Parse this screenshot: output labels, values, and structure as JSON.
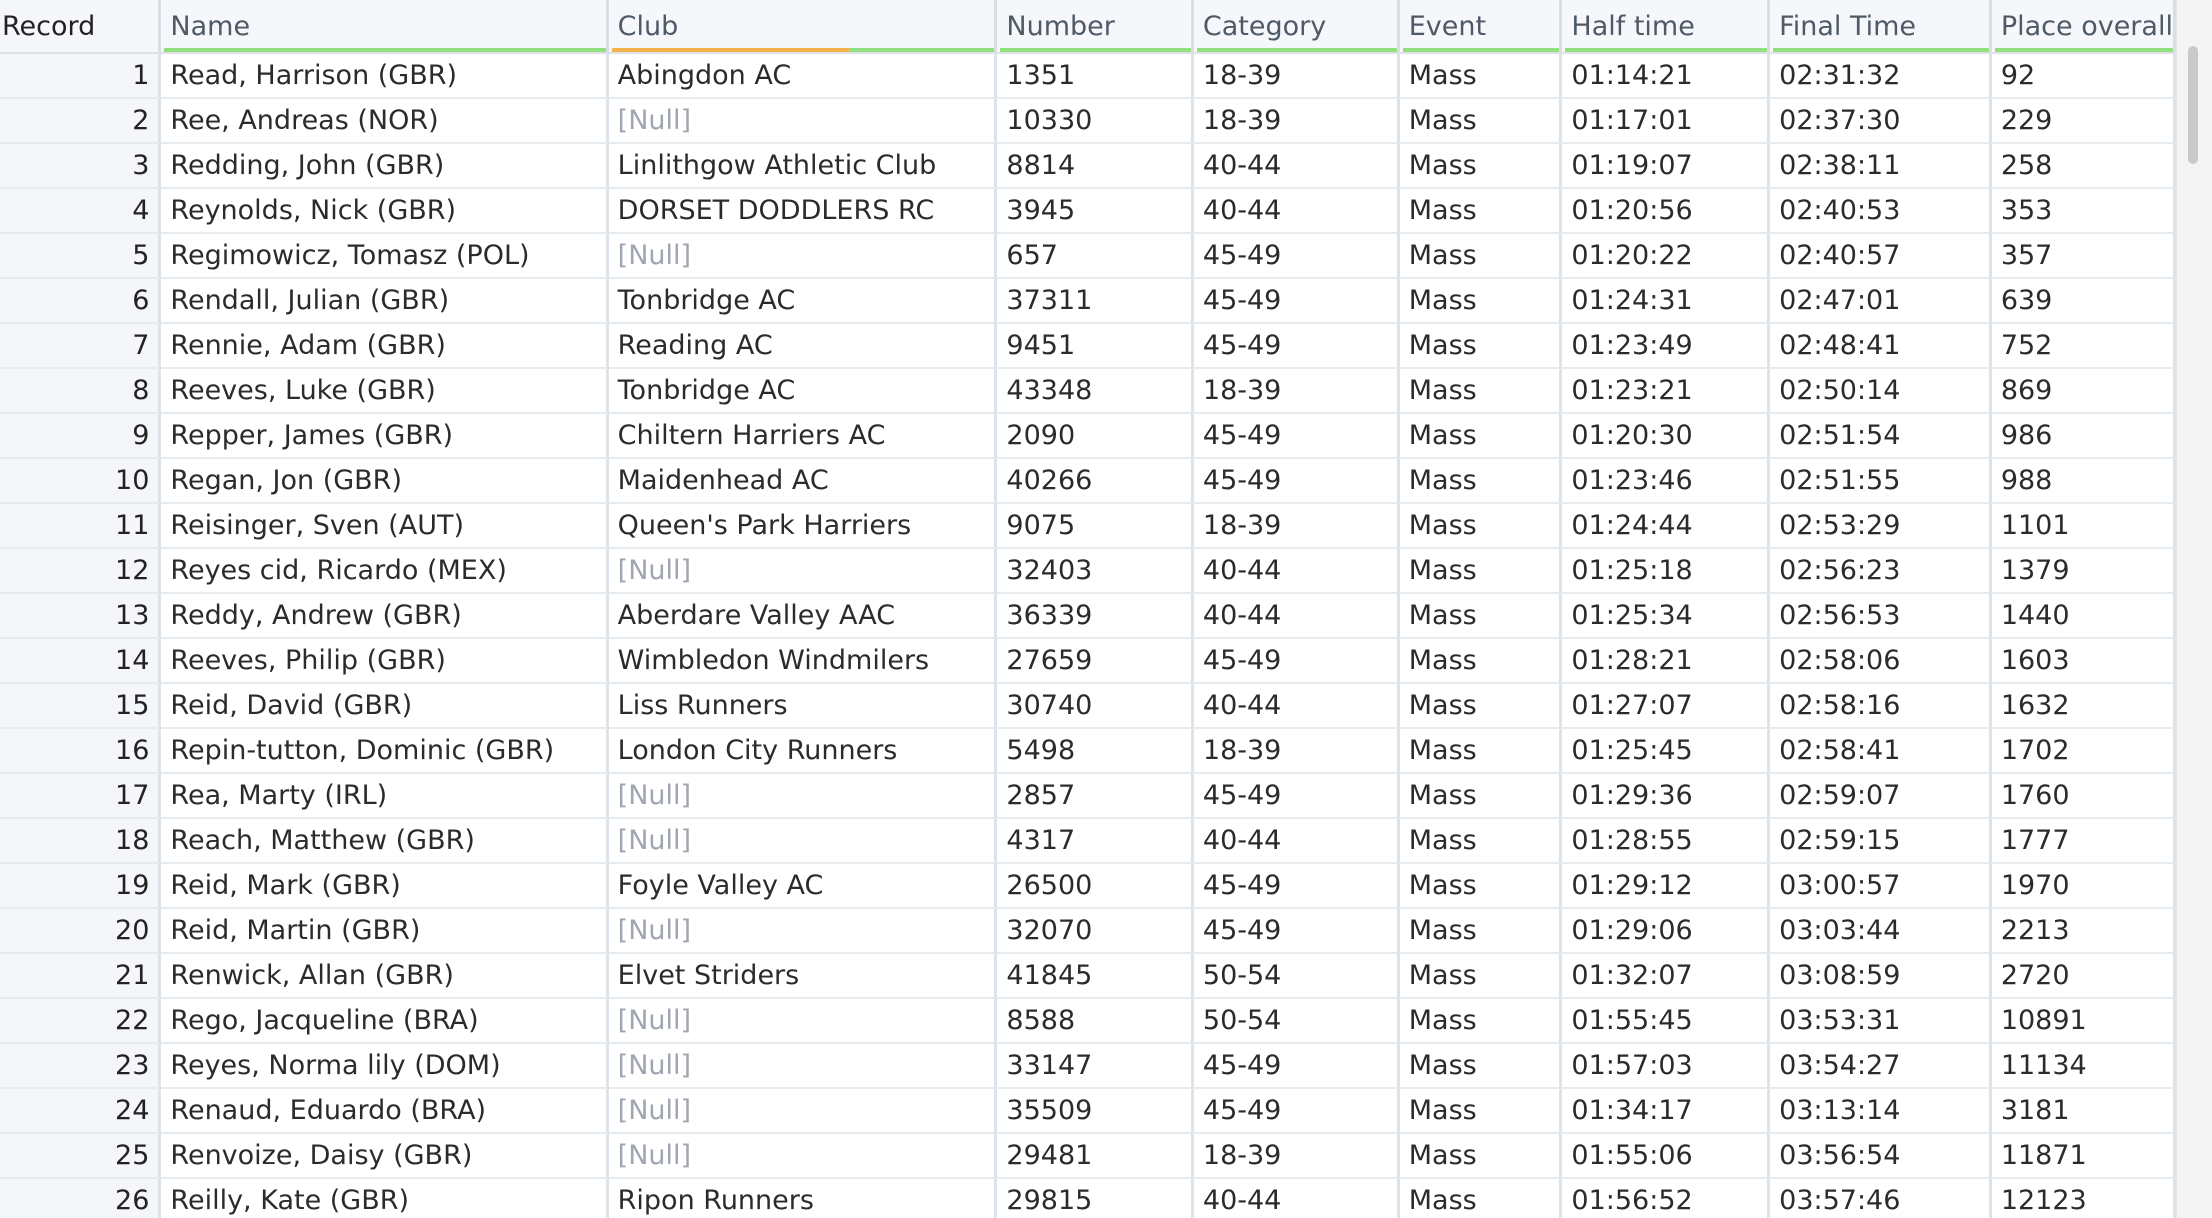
{
  "columns": [
    "Record",
    "Name",
    "Club",
    "Number",
    "Category",
    "Event",
    "Half time",
    "Final Time",
    "Place overall"
  ],
  "rows": [
    [
      "1",
      "Read, Harrison (GBR)",
      "Abingdon AC",
      "1351",
      "18-39",
      "Mass",
      "01:14:21",
      "02:31:32",
      "92"
    ],
    [
      "2",
      "Ree, Andreas (NOR)",
      "[Null]",
      "10330",
      "18-39",
      "Mass",
      "01:17:01",
      "02:37:30",
      "229"
    ],
    [
      "3",
      "Redding, John (GBR)",
      "Linlithgow Athletic Club",
      "8814",
      "40-44",
      "Mass",
      "01:19:07",
      "02:38:11",
      "258"
    ],
    [
      "4",
      "Reynolds, Nick (GBR)",
      "DORSET DODDLERS RC",
      "3945",
      "40-44",
      "Mass",
      "01:20:56",
      "02:40:53",
      "353"
    ],
    [
      "5",
      "Regimowicz, Tomasz (POL)",
      "[Null]",
      "657",
      "45-49",
      "Mass",
      "01:20:22",
      "02:40:57",
      "357"
    ],
    [
      "6",
      "Rendall, Julian (GBR)",
      "Tonbridge AC",
      "37311",
      "45-49",
      "Mass",
      "01:24:31",
      "02:47:01",
      "639"
    ],
    [
      "7",
      "Rennie, Adam (GBR)",
      "Reading AC",
      "9451",
      "45-49",
      "Mass",
      "01:23:49",
      "02:48:41",
      "752"
    ],
    [
      "8",
      "Reeves, Luke (GBR)",
      "Tonbridge AC",
      "43348",
      "18-39",
      "Mass",
      "01:23:21",
      "02:50:14",
      "869"
    ],
    [
      "9",
      "Repper, James (GBR)",
      "Chiltern Harriers AC",
      "2090",
      "45-49",
      "Mass",
      "01:20:30",
      "02:51:54",
      "986"
    ],
    [
      "10",
      "Regan, Jon (GBR)",
      "Maidenhead AC",
      "40266",
      "45-49",
      "Mass",
      "01:23:46",
      "02:51:55",
      "988"
    ],
    [
      "11",
      "Reisinger, Sven (AUT)",
      "Queen's Park Harriers",
      "9075",
      "18-39",
      "Mass",
      "01:24:44",
      "02:53:29",
      "1101"
    ],
    [
      "12",
      "Reyes cid, Ricardo (MEX)",
      "[Null]",
      "32403",
      "40-44",
      "Mass",
      "01:25:18",
      "02:56:23",
      "1379"
    ],
    [
      "13",
      "Reddy, Andrew (GBR)",
      "Aberdare Valley AAC",
      "36339",
      "40-44",
      "Mass",
      "01:25:34",
      "02:56:53",
      "1440"
    ],
    [
      "14",
      "Reeves, Philip (GBR)",
      "Wimbledon Windmilers",
      "27659",
      "45-49",
      "Mass",
      "01:28:21",
      "02:58:06",
      "1603"
    ],
    [
      "15",
      "Reid, David (GBR)",
      "Liss Runners",
      "30740",
      "40-44",
      "Mass",
      "01:27:07",
      "02:58:16",
      "1632"
    ],
    [
      "16",
      "Repin-tutton, Dominic (GBR)",
      "London City Runners",
      "5498",
      "18-39",
      "Mass",
      "01:25:45",
      "02:58:41",
      "1702"
    ],
    [
      "17",
      "Rea, Marty (IRL)",
      "[Null]",
      "2857",
      "45-49",
      "Mass",
      "01:29:36",
      "02:59:07",
      "1760"
    ],
    [
      "18",
      "Reach, Matthew (GBR)",
      "[Null]",
      "4317",
      "40-44",
      "Mass",
      "01:28:55",
      "02:59:15",
      "1777"
    ],
    [
      "19",
      "Reid, Mark (GBR)",
      "Foyle Valley AC",
      "26500",
      "45-49",
      "Mass",
      "01:29:12",
      "03:00:57",
      "1970"
    ],
    [
      "20",
      "Reid, Martin (GBR)",
      "[Null]",
      "32070",
      "45-49",
      "Mass",
      "01:29:06",
      "03:03:44",
      "2213"
    ],
    [
      "21",
      "Renwick, Allan (GBR)",
      "Elvet Striders",
      "41845",
      "50-54",
      "Mass",
      "01:32:07",
      "03:08:59",
      "2720"
    ],
    [
      "22",
      "Rego, Jacqueline (BRA)",
      "[Null]",
      "8588",
      "50-54",
      "Mass",
      "01:55:45",
      "03:53:31",
      "10891"
    ],
    [
      "23",
      "Reyes, Norma lily (DOM)",
      "[Null]",
      "33147",
      "45-49",
      "Mass",
      "01:57:03",
      "03:54:27",
      "11134"
    ],
    [
      "24",
      "Renaud, Eduardo (BRA)",
      "[Null]",
      "35509",
      "45-49",
      "Mass",
      "01:34:17",
      "03:13:14",
      "3181"
    ],
    [
      "25",
      "Renvoize, Daisy (GBR)",
      "[Null]",
      "29481",
      "18-39",
      "Mass",
      "01:55:06",
      "03:56:54",
      "11871"
    ],
    [
      "26",
      "Reilly, Kate (GBR)",
      "Ripon Runners",
      "29815",
      "40-44",
      "Mass",
      "01:56:52",
      "03:57:46",
      "12123"
    ]
  ],
  "null_text": "[Null]"
}
